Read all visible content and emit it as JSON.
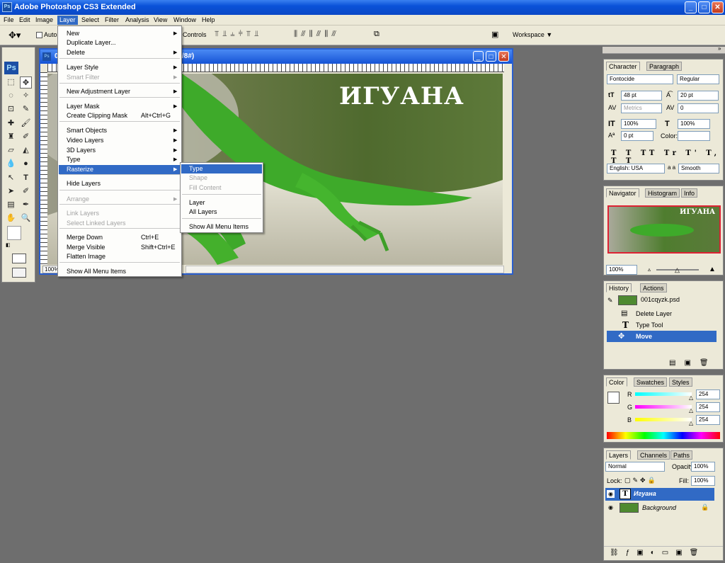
{
  "window": {
    "title": "Adobe Photoshop CS3 Extended",
    "min": "_",
    "max": "□",
    "close": "✕"
  },
  "menubar": {
    "items": [
      "File",
      "Edit",
      "Image",
      "Layer",
      "Select",
      "Filter",
      "Analysis",
      "View",
      "Window",
      "Help"
    ],
    "active": "Layer"
  },
  "options": {
    "auto_label": "Auto",
    "controls_label": "Controls",
    "workspace_label": "Workspace"
  },
  "document": {
    "tab_left": "0",
    "tab_right": "/8#)",
    "zoom": "100%",
    "image_text": "ИГУАНА"
  },
  "layer_menu": {
    "items": [
      {
        "label": "New",
        "shortcut": "",
        "sub": true,
        "disabled": false
      },
      {
        "label": "Duplicate Layer...",
        "shortcut": "",
        "sub": false,
        "disabled": false
      },
      {
        "label": "Delete",
        "shortcut": "",
        "sub": true,
        "disabled": false
      },
      {
        "label": "Layer Style",
        "shortcut": "",
        "sub": true,
        "disabled": false
      },
      {
        "label": "Smart Filter",
        "shortcut": "",
        "sub": true,
        "disabled": true
      },
      {
        "label": "New Adjustment Layer",
        "shortcut": "",
        "sub": true,
        "disabled": false
      },
      {
        "label": "Layer Mask",
        "shortcut": "",
        "sub": true,
        "disabled": false
      },
      {
        "label": "Create Clipping Mask",
        "shortcut": "Alt+Ctrl+G",
        "sub": false,
        "disabled": false
      },
      {
        "label": "Smart Objects",
        "shortcut": "",
        "sub": true,
        "disabled": false
      },
      {
        "label": "Video Layers",
        "shortcut": "",
        "sub": true,
        "disabled": false
      },
      {
        "label": "3D Layers",
        "shortcut": "",
        "sub": true,
        "disabled": false
      },
      {
        "label": "Type",
        "shortcut": "",
        "sub": true,
        "disabled": false
      },
      {
        "label": "Rasterize",
        "shortcut": "",
        "sub": true,
        "disabled": false,
        "highlight": true
      },
      {
        "label": "Hide Layers",
        "shortcut": "",
        "sub": false,
        "disabled": false
      },
      {
        "label": "Arrange",
        "shortcut": "",
        "sub": true,
        "disabled": true
      },
      {
        "label": "Link Layers",
        "shortcut": "",
        "sub": false,
        "disabled": true
      },
      {
        "label": "Select Linked Layers",
        "shortcut": "",
        "sub": false,
        "disabled": true
      },
      {
        "label": "Merge Down",
        "shortcut": "Ctrl+E",
        "sub": false,
        "disabled": false
      },
      {
        "label": "Merge Visible",
        "shortcut": "Shift+Ctrl+E",
        "sub": false,
        "disabled": false
      },
      {
        "label": "Flatten Image",
        "shortcut": "",
        "sub": false,
        "disabled": false
      },
      {
        "label": "Show All Menu Items",
        "shortcut": "",
        "sub": false,
        "disabled": false
      }
    ]
  },
  "rasterize_menu": {
    "items": [
      {
        "label": "Type",
        "disabled": false,
        "highlight": true
      },
      {
        "label": "Shape",
        "disabled": true
      },
      {
        "label": "Fill Content",
        "disabled": true
      },
      {
        "label": "Layer",
        "disabled": false
      },
      {
        "label": "All Layers",
        "disabled": false
      },
      {
        "label": "Show All Menu Items",
        "disabled": false
      }
    ]
  },
  "character": {
    "tab1": "Character",
    "tab2": "Paragraph",
    "font": "Fontocide",
    "style": "Regular",
    "size": "48 pt",
    "leading": "20 pt",
    "kerning": "Metrics",
    "tracking": "0",
    "vscale": "100%",
    "hscale": "100%",
    "baseline": "0 pt",
    "color_label": "Color:",
    "language": "English: USA",
    "aa_label": "a a",
    "aa": "Smooth"
  },
  "navigator": {
    "tab1": "Navigator",
    "tab2": "Histogram",
    "tab3": "Info",
    "zoom": "100%",
    "thumb_text": "ИГУАНА"
  },
  "history": {
    "tab1": "History",
    "tab2": "Actions",
    "snapshot": "001cqyzk.psd",
    "items": [
      "Delete Layer",
      "Type Tool",
      "Move"
    ]
  },
  "color": {
    "tab1": "Color",
    "tab2": "Swatches",
    "tab3": "Styles",
    "r_label": "R",
    "g_label": "G",
    "b_label": "B",
    "r": "254",
    "g": "254",
    "b": "254"
  },
  "layers": {
    "tab1": "Layers",
    "tab2": "Channels",
    "tab3": "Paths",
    "mode": "Normal",
    "opacity_label": "Opacity:",
    "opacity": "100%",
    "lock_label": "Lock:",
    "fill_label": "Fill:",
    "fill": "100%",
    "items": [
      "Игуана",
      "Background"
    ]
  }
}
